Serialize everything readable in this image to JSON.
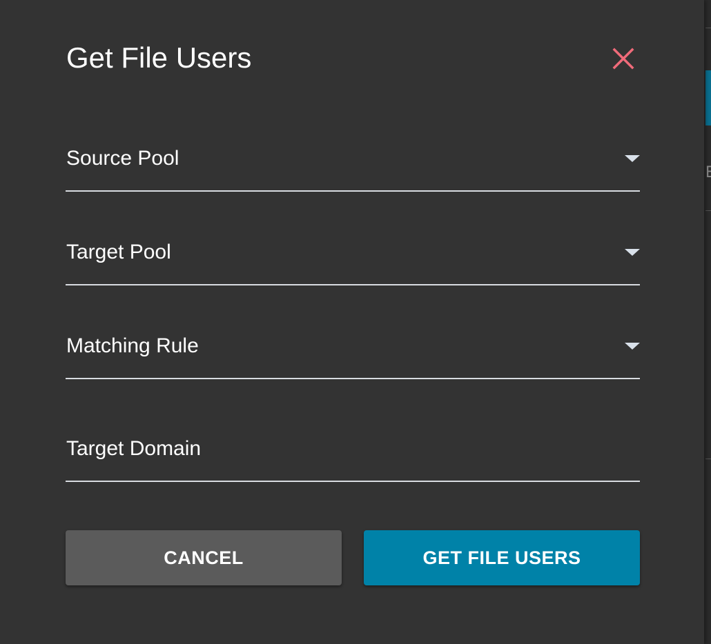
{
  "dialog": {
    "title": "Get File Users",
    "close_icon": "close-icon",
    "close_color": "#f06b7a"
  },
  "fields": {
    "source_pool": {
      "label": "Source Pool",
      "type": "select",
      "value": ""
    },
    "target_pool": {
      "label": "Target Pool",
      "type": "select",
      "value": ""
    },
    "matching_rule": {
      "label": "Matching Rule",
      "type": "select",
      "value": ""
    },
    "target_domain": {
      "label": "Target Domain",
      "type": "text",
      "value": ""
    }
  },
  "actions": {
    "cancel_label": "CANCEL",
    "submit_label": "GET FILE USERS"
  },
  "background": {
    "partial_letter": "E"
  },
  "colors": {
    "dialog_bg": "#333333",
    "primary": "#0082a8",
    "secondary": "#5b5b5b",
    "underline": "#d9dde2",
    "text": "#ffffff"
  }
}
